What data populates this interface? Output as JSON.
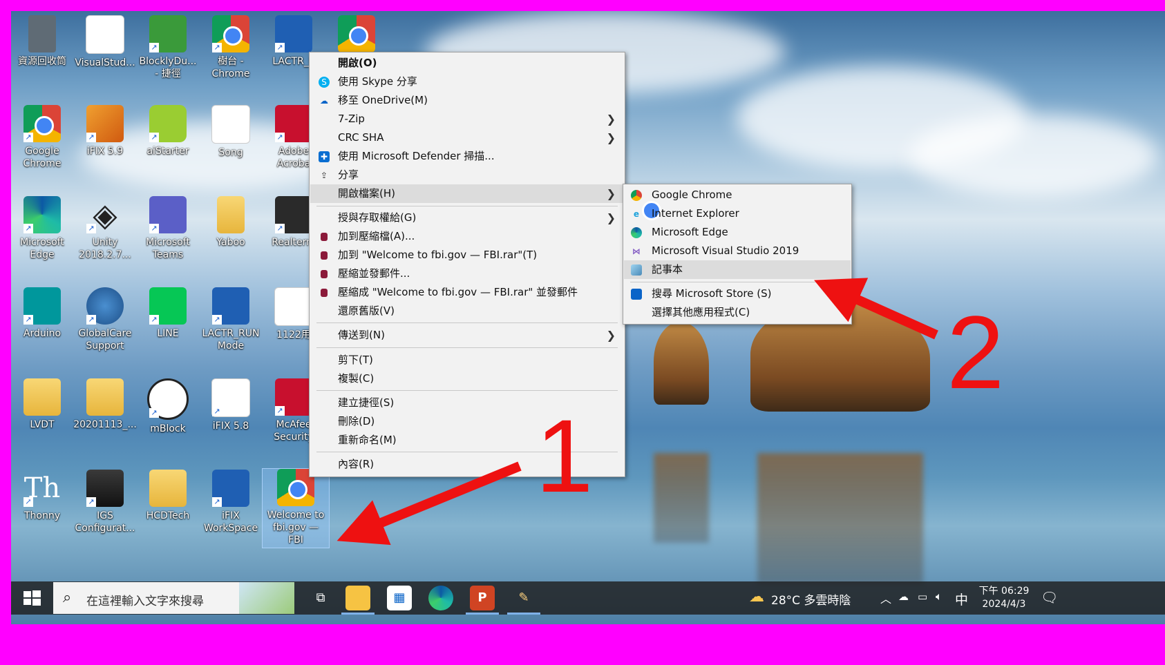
{
  "desktop": {
    "icons": [
      {
        "label": "資源回收筒",
        "icon": "recycle-bin-icon"
      },
      {
        "label": "VisualStud...",
        "icon": "document-icon"
      },
      {
        "label": "BlocklyDu...\n- 捷徑",
        "icon": "blockly-icon"
      },
      {
        "label": "樹台 -\nChrome",
        "icon": "chrome-profile-icon"
      },
      {
        "label": "LACTR_E",
        "icon": "lactr-icon"
      },
      {
        "label": "",
        "icon": "chrome-icon"
      },
      {
        "label": "Google\nChrome",
        "icon": "chrome-icon"
      },
      {
        "label": "iFIX 5.9",
        "icon": "ifix-icon"
      },
      {
        "label": "aiStarter",
        "icon": "android-icon"
      },
      {
        "label": "Song",
        "icon": "document-icon"
      },
      {
        "label": "Adobe\nAcroba",
        "icon": "acrobat-icon"
      },
      {
        "label": "Microsoft\nEdge",
        "icon": "edge-icon"
      },
      {
        "label": "Unity\n2018.2.7...",
        "icon": "unity-icon"
      },
      {
        "label": "Microsoft\nTeams",
        "icon": "teams-icon"
      },
      {
        "label": "Yaboo",
        "icon": "folder-icon"
      },
      {
        "label": "Realterm",
        "icon": "realterm-icon"
      },
      {
        "label": "Arduino",
        "icon": "arduino-icon"
      },
      {
        "label": "GlobalCare\nSupport",
        "icon": "globalcare-icon"
      },
      {
        "label": "LINE",
        "icon": "line-icon"
      },
      {
        "label": "LACTR_RUN\nMode",
        "icon": "lactr-icon"
      },
      {
        "label": "1122用",
        "icon": "document-icon"
      },
      {
        "label": "LVDT",
        "icon": "folder-icon"
      },
      {
        "label": "20201113_...",
        "icon": "pdf-folder-icon"
      },
      {
        "label": "mBlock",
        "icon": "mblock-icon"
      },
      {
        "label": "iFIX 5.8",
        "icon": "document-icon"
      },
      {
        "label": "McAfee\nSecurity",
        "icon": "mcafee-icon"
      },
      {
        "label": "Thonny",
        "icon": "thonny-icon"
      },
      {
        "label": "IGS\nConfigurat...",
        "icon": "igs-icon"
      },
      {
        "label": "HCDTech",
        "icon": "folder-icon"
      },
      {
        "label": "iFIX\nWorkSpace",
        "icon": "ifix-workspace-icon"
      },
      {
        "label": "Welcome to\nfbi.gov —\nFBI",
        "icon": "chrome-icon"
      }
    ]
  },
  "context_menu": {
    "items": [
      {
        "label": "開啟(O)",
        "bold": true
      },
      {
        "label": "使用 Skype 分享",
        "icon": "skype-icon"
      },
      {
        "label": "移至 OneDrive(M)",
        "icon": "onedrive-icon"
      },
      {
        "label": "7-Zip",
        "submenu": true
      },
      {
        "label": "CRC SHA",
        "submenu": true
      },
      {
        "label": "使用 Microsoft Defender 掃描...",
        "icon": "defender-icon"
      },
      {
        "label": "分享",
        "icon": "share-icon"
      },
      {
        "label": "開啟檔案(H)",
        "submenu": true,
        "highlighted": true
      },
      {
        "label": "授與存取權給(G)",
        "submenu": true
      },
      {
        "label": "加到壓縮檔(A)...",
        "icon": "winrar-icon"
      },
      {
        "label": "加到 \"Welcome to fbi.gov — FBI.rar\"(T)",
        "icon": "winrar-icon"
      },
      {
        "label": "壓縮並發郵件...",
        "icon": "winrar-icon"
      },
      {
        "label": "壓縮成 \"Welcome to fbi.gov — FBI.rar\" 並發郵件",
        "icon": "winrar-icon"
      },
      {
        "label": "還原舊版(V)"
      },
      {
        "label": "傳送到(N)",
        "submenu": true
      },
      {
        "label": "剪下(T)"
      },
      {
        "label": "複製(C)"
      },
      {
        "label": "建立捷徑(S)"
      },
      {
        "label": "刪除(D)"
      },
      {
        "label": "重新命名(M)"
      },
      {
        "label": "內容(R)"
      }
    ]
  },
  "open_with_menu": {
    "items": [
      {
        "label": "Google Chrome",
        "icon": "chrome-icon"
      },
      {
        "label": "Internet Explorer",
        "icon": "ie-icon"
      },
      {
        "label": "Microsoft Edge",
        "icon": "edge-icon"
      },
      {
        "label": "Microsoft Visual Studio 2019",
        "icon": "visual-studio-icon"
      },
      {
        "label": "記事本",
        "icon": "notepad-icon",
        "highlighted": true
      },
      {
        "label": "搜尋 Microsoft Store (S)",
        "icon": "store-icon"
      },
      {
        "label": "選擇其他應用程式(C)"
      }
    ]
  },
  "annotations": {
    "step1": "1",
    "step2": "2",
    "color": "#ee1111"
  },
  "taskbar": {
    "search_placeholder": "在這裡輸入文字來搜尋",
    "weather": "28°C 多雲時陰",
    "ime": "中",
    "time": "下午 06:29",
    "date": "2024/4/3",
    "apps": [
      "task-view-icon",
      "file-explorer-icon",
      "microsoft-store-icon",
      "edge-icon",
      "powerpoint-icon",
      "paint-icon"
    ]
  },
  "colors": {
    "frame": "#ff00ff",
    "accent": "#0078d7"
  }
}
